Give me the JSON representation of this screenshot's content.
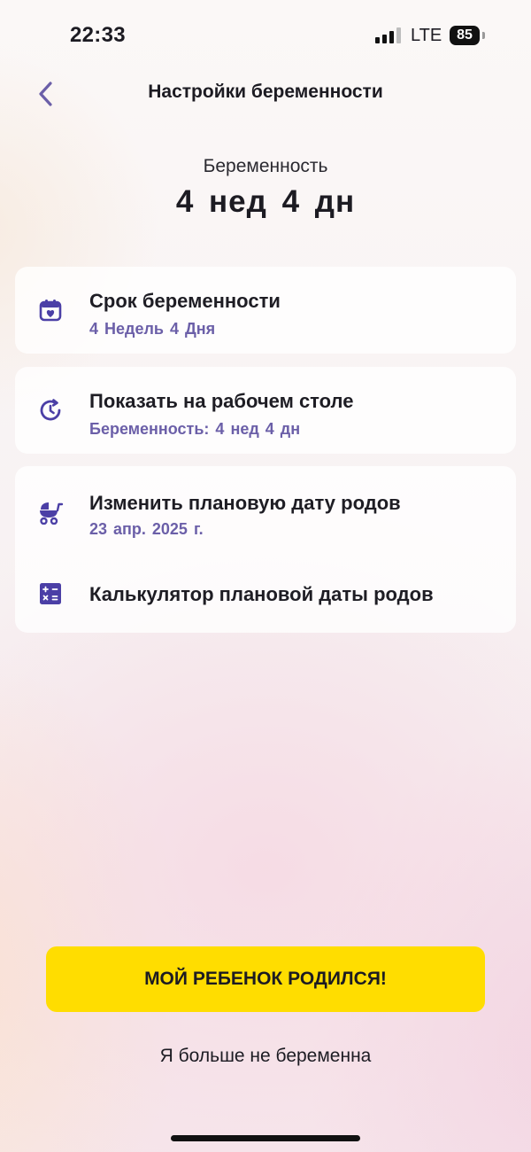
{
  "status_bar": {
    "time": "22:33",
    "network": "LTE",
    "battery": "85"
  },
  "header": {
    "back_icon": "chevron-left-icon",
    "title": "Настройки беременности"
  },
  "summary": {
    "label": "Беременность",
    "value": "4 нед 4 дн"
  },
  "cards": {
    "term": {
      "icon": "calendar-heart-icon",
      "title": "Срок беременности",
      "subtitle": "4 Недель 4 Дня"
    },
    "desktop": {
      "icon": "clock-refresh-icon",
      "title": "Показать на рабочем столе",
      "subtitle": "Беременность: 4 нед 4 дн"
    },
    "due_date": {
      "icon": "stroller-icon",
      "title": "Изменить плановую дату родов",
      "subtitle": "23 апр. 2025 г."
    },
    "calculator": {
      "icon": "calculator-icon",
      "title": "Калькулятор плановой даты родов"
    }
  },
  "actions": {
    "born_button": "МОЙ РЕБЕНОК РОДИЛСЯ!",
    "not_pregnant_link": "Я больше не беременна"
  },
  "colors": {
    "accent": "#4b3fa6",
    "subtitle": "#6b5fa8",
    "primary_button": "#ffdd00"
  }
}
